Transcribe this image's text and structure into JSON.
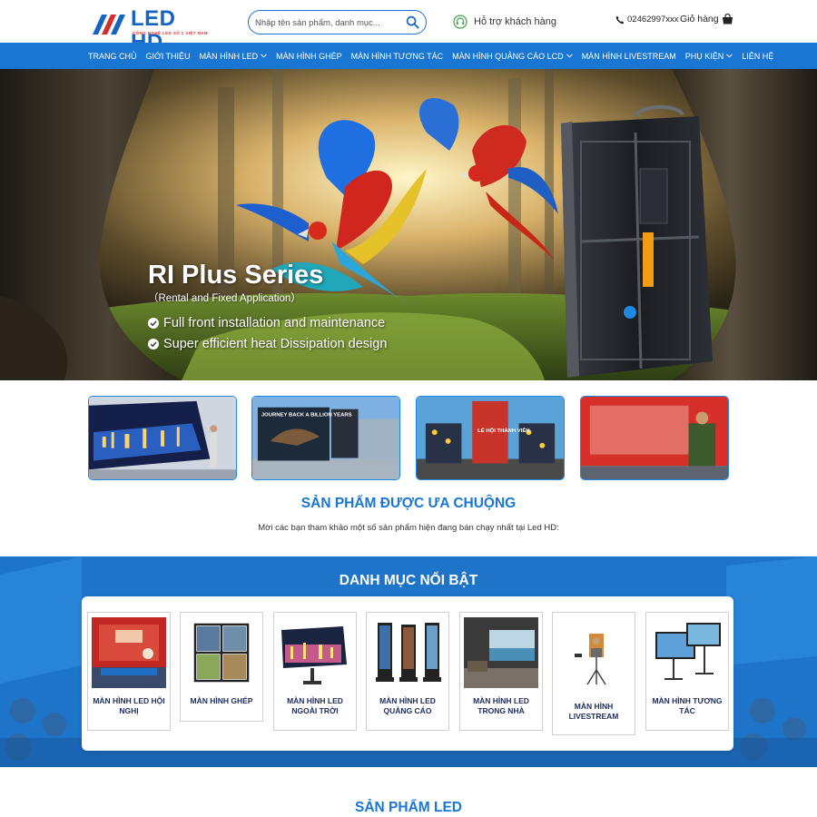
{
  "brand": {
    "name": "LED HD",
    "tagline": "CÔNG NGHỆ LED SỐ 1 VIỆT NAM",
    "primary_color": "#1976d2",
    "accent_color": "#d32f2f"
  },
  "search": {
    "placeholder": "Nhập tên sản phẩm, danh mục..."
  },
  "header": {
    "support_label": "Hỗ trợ khách hàng",
    "phone": "02462997xxx",
    "cart_label": "Giỏ hàng"
  },
  "nav": {
    "items": [
      {
        "label": "Trang chủ",
        "dropdown": false
      },
      {
        "label": "Giới thiệu",
        "dropdown": false
      },
      {
        "label": "Màn hình LED",
        "dropdown": true
      },
      {
        "label": "Màn hình ghép",
        "dropdown": false
      },
      {
        "label": "Màn hình tương tác",
        "dropdown": false
      },
      {
        "label": "Màn hình quảng cáo LCD",
        "dropdown": true
      },
      {
        "label": "Màn hình livestream",
        "dropdown": false
      },
      {
        "label": "Phụ kiện",
        "dropdown": true
      },
      {
        "label": "Liên hệ",
        "dropdown": false
      }
    ]
  },
  "hero": {
    "title": "RI Plus Series",
    "subtitle": "（Rental and Fixed Application）",
    "features": [
      "Full front installation and maintenance",
      "Super efficient heat Dissipation design"
    ]
  },
  "thumbnails": [
    "video-wall-office",
    "billboard-dinosaur",
    "stage-led-tower",
    "conference-stage-screen"
  ],
  "thumb_text": {
    "billboard": "JOURNEY BACK A BILLION YEARS",
    "stage": "LẺ HỘI THÀNH VIÊN"
  },
  "popular": {
    "title": "SẢN PHẨM ĐƯỢC ƯA CHUỘNG",
    "description": "Mời các bạn tham khảo một số sản phẩm hiện đang bán chạy nhất tại Led HD:"
  },
  "categories": {
    "title": "DANH MỤC NỔI BẬT",
    "items": [
      {
        "label": "MÀN HÌNH LED HỘI NGHỊ",
        "icon": "conference-led-image"
      },
      {
        "label": "MÀN HÌNH GHÉP",
        "icon": "video-wall-image"
      },
      {
        "label": "MÀN HÌNH LED NGOÀI TRỜI",
        "icon": "outdoor-led-image"
      },
      {
        "label": "MÀN HÌNH LED QUẢNG CÁO",
        "icon": "advertising-kiosk-image"
      },
      {
        "label": "MÀN HÌNH LED TRONG NHÀ",
        "icon": "indoor-led-image"
      },
      {
        "label": "MÀN HÌNH LIVESTREAM",
        "icon": "livestream-screen-image"
      },
      {
        "label": "MÀN HÌNH TƯƠNG TÁC",
        "icon": "interactive-board-image"
      }
    ]
  },
  "led_section": {
    "title": "SẢN PHẨM LED"
  }
}
